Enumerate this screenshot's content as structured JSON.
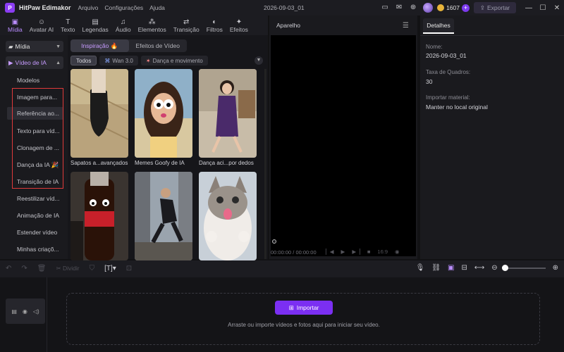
{
  "app": {
    "logo": "P",
    "name": "HitPaw Edimakor",
    "menu": [
      "Arquivo",
      "Configurações",
      "Ajuda"
    ],
    "project_title": "2026-09-03_01",
    "credits": "1607",
    "export_label": "Exportar",
    "accent_color": "#8b3df2"
  },
  "toolbar": {
    "tabs": [
      {
        "label": "Mídia",
        "icon": "media-icon",
        "glyph": "▣",
        "active": true
      },
      {
        "label": "Avatar AI",
        "icon": "avatar-ai-icon",
        "glyph": "☺"
      },
      {
        "label": "Texto",
        "icon": "text-icon",
        "glyph": "T"
      },
      {
        "label": "Legendas",
        "icon": "captions-icon",
        "glyph": "▤"
      },
      {
        "label": "Áudio",
        "icon": "audio-icon",
        "glyph": "♫"
      },
      {
        "label": "Elementos",
        "icon": "elements-icon",
        "glyph": "⁂"
      },
      {
        "label": "Transição",
        "icon": "transition-icon",
        "glyph": "⇄"
      },
      {
        "label": "Filtros",
        "icon": "filters-icon",
        "glyph": "◐"
      },
      {
        "label": "Efeitos",
        "icon": "effects-icon",
        "glyph": "✦"
      }
    ]
  },
  "sidebar": {
    "media_label": "Mídia",
    "ai_video_label": "Vídeo de IA",
    "items": [
      {
        "label": "Modelos"
      },
      {
        "label": "Imagem para..."
      },
      {
        "label": "Referência ao..."
      },
      {
        "label": "Texto para víd..."
      },
      {
        "label": "Clonagem de ..."
      },
      {
        "label": "Dança da IA 🎉"
      },
      {
        "label": "Transição de IA"
      },
      {
        "label": "Reestilizar víd..."
      },
      {
        "label": "Animação de IA"
      },
      {
        "label": "Estender vídeo"
      },
      {
        "label": "Minhas criaçõ..."
      }
    ]
  },
  "library": {
    "segments": [
      "Inspiração 🔥",
      "Efeitos de Vídeo"
    ],
    "chips": [
      "Todos",
      "Wan 3.0",
      "Dança e movimento"
    ],
    "cards": [
      {
        "label": "Sapatos a...avançados"
      },
      {
        "label": "Memes Goofy de IA"
      },
      {
        "label": "Dança aci...por dedos"
      },
      {
        "label": ""
      },
      {
        "label": ""
      },
      {
        "label": ""
      }
    ]
  },
  "preview": {
    "title": "Aparelho",
    "time": "00:00:00 / 00:00:00",
    "ratio": "16:9"
  },
  "details": {
    "tab": "Detalhes",
    "name_label": "Nome:",
    "name_value": "2026-09-03_01",
    "fps_label": "Taxa de Quadros:",
    "fps_value": "30",
    "import_label": "Importar material:",
    "import_value": "Manter no local original"
  },
  "timeline": {
    "split_label": "Dividir",
    "import_button": "Importar",
    "hint": "Arraste ou importe vídeos e fotos aqui para iniciar seu vídeo."
  }
}
